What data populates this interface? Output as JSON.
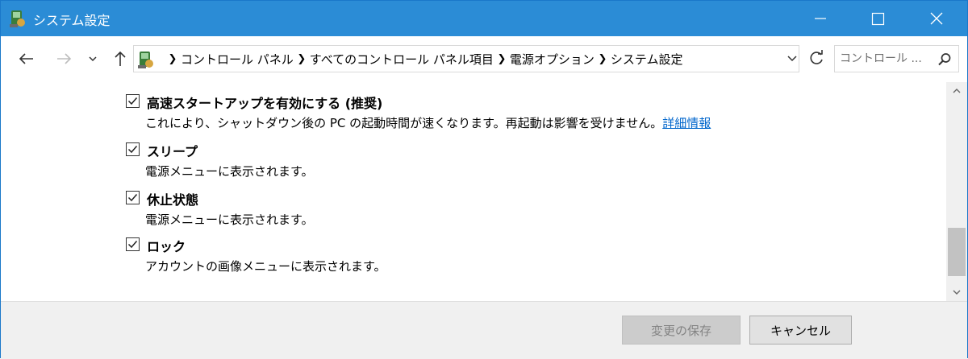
{
  "window": {
    "title": "システム設定",
    "accent_color": "#2b8cd6"
  },
  "nav": {
    "breadcrumbs": [
      "コントロール パネル",
      "すべてのコントロール パネル項目",
      "電源オプション",
      "システム設定"
    ],
    "search_placeholder": "コントロール ..."
  },
  "settings": [
    {
      "label": "高速スタートアップを有効にする (推奨)",
      "checked": true,
      "description": "これにより、シャットダウン後の PC の起動時間が速くなります。再起動は影響を受けません。",
      "link": "詳細情報"
    },
    {
      "label": "スリープ",
      "checked": true,
      "description": "電源メニューに表示されます。"
    },
    {
      "label": "休止状態",
      "checked": true,
      "description": "電源メニューに表示されます。"
    },
    {
      "label": "ロック",
      "checked": true,
      "description": "アカウントの画像メニューに表示されます。"
    }
  ],
  "footer": {
    "save_label": "変更の保存",
    "cancel_label": "キャンセル"
  },
  "icons": {
    "app": "control-panel-icon",
    "back": "arrow-left-icon",
    "forward": "arrow-right-icon",
    "up": "arrow-up-icon",
    "refresh": "refresh-icon",
    "search": "search-icon",
    "minimize": "minimize-icon",
    "maximize": "maximize-icon",
    "close": "close-icon"
  }
}
